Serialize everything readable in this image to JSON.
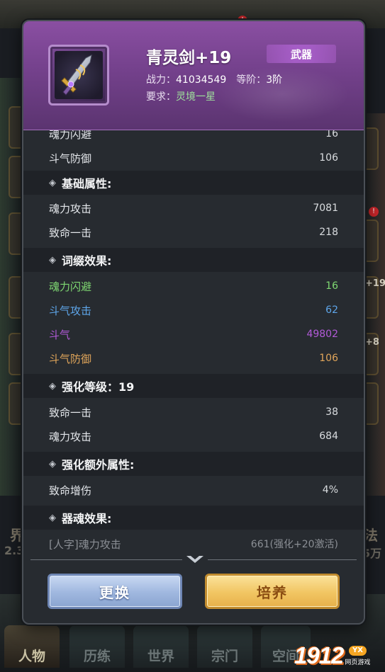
{
  "background": {
    "top_title": "",
    "left_char": "界",
    "left_value": "2.3",
    "right_char": "法",
    "right_value": "5万",
    "right_badges": [
      "+19",
      "+8"
    ],
    "bottom_tabs": [
      "人物",
      "历练",
      "世界",
      "宗门",
      "空间"
    ],
    "watermark": {
      "number": "1912",
      "tag": "YX",
      "sub": "网页游戏"
    }
  },
  "item": {
    "name": "青灵剑+19",
    "type": "武器",
    "power_label": "战力：",
    "power_value": "41034549",
    "rank_label": "等阶：",
    "rank_value": "3阶",
    "req_label": "要求：",
    "req_value": "灵境一星",
    "icon": "sword-icon"
  },
  "colors": {
    "header": "#74418c",
    "green": "#7fd872",
    "blue": "#5ea6ea",
    "purple": "#b25ad8",
    "gold": "#e0a55a"
  },
  "rows": {
    "partial_top": {
      "label": "魂力闪避",
      "value": "16"
    },
    "top_def": {
      "label": "斗气防御",
      "value": "106"
    },
    "sec_base": "基础属性:",
    "base": [
      {
        "label": "魂力攻击",
        "value": "7081"
      },
      {
        "label": "致命一击",
        "value": "218"
      }
    ],
    "sec_affix": "词缀效果:",
    "affix": [
      {
        "label": "魂力闪避",
        "value": "16"
      },
      {
        "label": "斗气攻击",
        "value": "62"
      },
      {
        "label": "斗气",
        "value": "49802"
      },
      {
        "label": "斗气防御",
        "value": "106"
      }
    ],
    "sec_enhance": "强化等级：19",
    "enhance": [
      {
        "label": "致命一击",
        "value": "38"
      },
      {
        "label": "魂力攻击",
        "value": "684"
      }
    ],
    "sec_extra": "强化额外属性:",
    "extra": [
      {
        "label": "致命增伤",
        "value": "4%"
      }
    ],
    "sec_soul": "器魂效果:",
    "soul": [
      {
        "label": "[人字]魂力攻击",
        "value": "661(强化+20激活)"
      }
    ]
  },
  "buttons": {
    "swap": "更换",
    "train": "培养"
  }
}
